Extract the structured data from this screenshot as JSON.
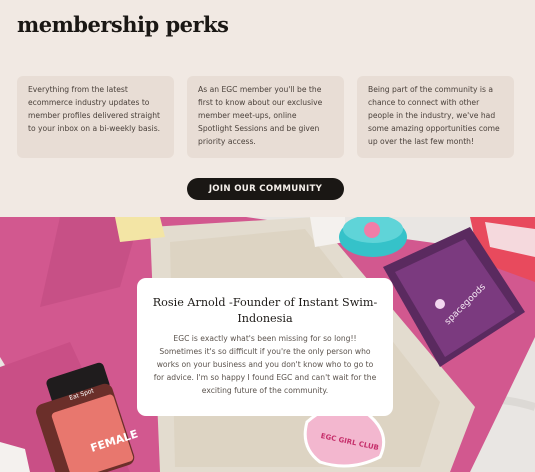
{
  "heading": "membership perks",
  "perks": [
    {
      "text": "Everything from the latest ecommerce industry updates to member profiles delivered straight to your inbox on a bi-weekly basis."
    },
    {
      "text": "As an EGC member you'll be the first to know about our exclusive member meet-ups, online Spotlight Sessions and be given priority access."
    },
    {
      "text": "Being part of the community is a chance to connect with other people in the industry, we've had some amazing opportunities come up over the last few month!"
    }
  ],
  "cta": {
    "label": "JOIN OUR COMMUNITY"
  },
  "testimonial": {
    "name": "Rosie Arnold -Founder of Instant Swim-Indonesia",
    "quote": "EGC is exactly what's been missing for so long!! Sometimes it's so difficult if you're the only person who works on your business and you don't know who to go to for advice. I'm so happy I found EGC and can't wait for the exciting future of the community."
  },
  "photo_labels": {
    "bottle_brand": "Eat Spot",
    "bottle_label": "FEMALE",
    "sachet_brand": "spacegoods",
    "sticker_text": "EGC GIRL CLUB"
  },
  "colors": {
    "background": "#f1e9e3",
    "card": "#e8ddd5",
    "button": "#1a1714",
    "pink": "#d2588f"
  }
}
